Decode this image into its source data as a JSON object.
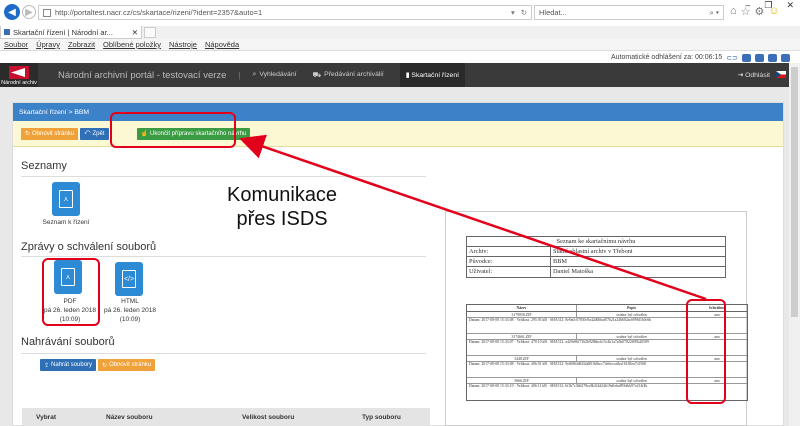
{
  "browser": {
    "url": "http://portaltest.nacr.cz/cs/skartace/rizeni/?ident=2357&auto=1",
    "search_placeholder": "Hledat...",
    "tab_title": "Skartační řízení | Národní ar...",
    "window": [
      "–",
      "❐",
      "✕"
    ]
  },
  "menu": [
    "Soubor",
    "Úpravy",
    "Zobrazit",
    "Oblíbené položky",
    "Nástroje",
    "Nápověda"
  ],
  "session": {
    "label": "Automatické odhlášení za: 00:06:15"
  },
  "app": {
    "logo_text": "Národní archiv",
    "title": "Národní archivní portál - testovací verze",
    "nav": [
      "Vyhledávání",
      "Předávání archiválií",
      "Skartační řízení"
    ],
    "logout": "Odhlásit"
  },
  "breadcrumb": "Skartační řízení > BBM",
  "buttons": {
    "refresh": "Obnovit stránku",
    "back": "Zpět",
    "finish": "Ukončit přípravu skartačního návrhu"
  },
  "sections": {
    "lists": "Seznamy",
    "approval": "Zprávy o schválení souborů",
    "upload": "Nahrávání souborů"
  },
  "list_item": "Seznam k řízení",
  "approval_files": [
    {
      "type": "PDF",
      "date": "pá 26. leden 2018",
      "time": "(10:09)"
    },
    {
      "type": "HTML",
      "date": "pá 26. leden 2018",
      "time": "(10:09)"
    }
  ],
  "upload_buttons": {
    "upload": "Nahrát soubory",
    "refresh": "Obnovit stránku"
  },
  "table_headers": [
    "Vybrat",
    "Název souboru",
    "Velikost souboru",
    "Typ souboru"
  ],
  "annotation": [
    "Komunikace",
    "přes ISDS"
  ],
  "document": {
    "title": "Seznam ke skartačnímu návrhu",
    "rows": [
      {
        "k": "Archiv:",
        "v": "Státní oblastní archiv v Třeboni"
      },
      {
        "k": "Původce:",
        "v": "BBM"
      },
      {
        "k": "Uživatel:",
        "v": "Daniel Matoška"
      }
    ],
    "file_headers": [
      "Název",
      "Popis",
      "Schváleno"
    ],
    "files": [
      {
        "name": "3179858.ZIP",
        "desc": "soubor byl schválen",
        "ok": "ano",
        "meta": "Datum: 2017-08-08 15:33:08 · Velikost: 295.93 kB · SHA512: 8e9a0c07830c9a42d06baf07b21a246682ac6996f1b0c6b"
      },
      {
        "name": "3174661.ZIP",
        "desc": "soubor byl schválen",
        "ok": "ano",
        "meta": "Datum: 2017-08-08 15:33:07 · Velikost: 478.10 kB · SHA512: a429e96f7162b928bbcb15c2b1a7a5b07822695b20589"
      },
      {
        "name": "5448.ZIP",
        "desc": "soubor byl schválen",
        "ok": "ano",
        "meta": "Datum: 2017-08-08 15:33:08 · Velikost: 406.91 kB · SHA512: 9ef6864d6f32a801b8acc74e6eccafba16138ea7c5568"
      },
      {
        "name": "5666.ZIP",
        "desc": "soubor byl schválen",
        "ok": "ano",
        "meta": "Datum: 2017-08-08 15:33:19 · Velikost: 406.11 kB · SHA512: 6f1b7c3b6278ec8b2f4d24b19a0eba893dbb97cd14f4b"
      }
    ]
  },
  "colors": {
    "appbar": "#3a3a3a",
    "breadcrumb": "#3c82c9",
    "highlight": "#e3001b",
    "orange": "#f0a23a",
    "green": "#3a9b43",
    "blue": "#2f6fb6"
  }
}
